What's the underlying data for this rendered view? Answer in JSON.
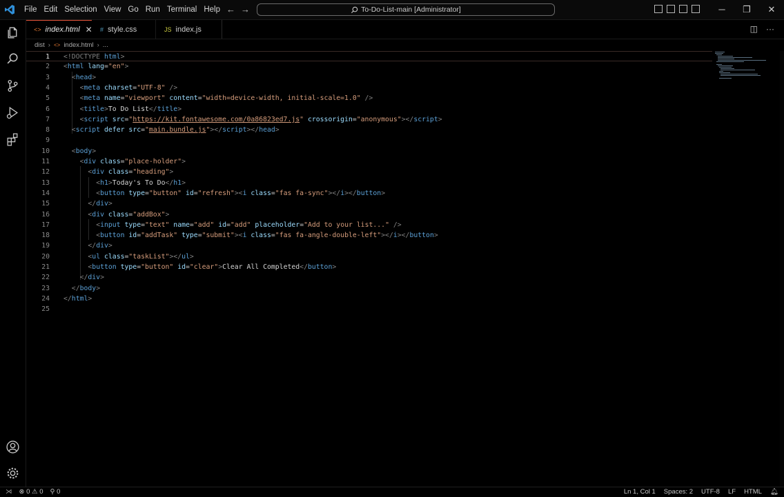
{
  "titlebar": {
    "menu": [
      "File",
      "Edit",
      "Selection",
      "View",
      "Go",
      "Run",
      "Terminal",
      "Help"
    ],
    "command_center": "To-Do-List-main [Administrator]"
  },
  "tabs": [
    {
      "icon": "<>",
      "label": "index.html",
      "active": true
    },
    {
      "icon": "#",
      "label": "style.css",
      "active": false
    },
    {
      "icon": "JS",
      "label": "index.js",
      "active": false
    }
  ],
  "breadcrumb": {
    "folder": "dist",
    "file": "index.html",
    "symbol": "..."
  },
  "editor": {
    "current_line": 1,
    "lines": [
      {
        "n": "1",
        "html": "<span class='t-tag'>&lt;!DOCTYPE</span><span class='t-name'> html</span><span class='t-tag'>&gt;</span>"
      },
      {
        "n": "2",
        "html": "<span class='t-tag'>&lt;</span><span class='t-name'>html</span> <span class='t-attr'>lang</span><span class='t-txt'>=</span><span class='t-val'>\"en\"</span><span class='t-tag'>&gt;</span>"
      },
      {
        "n": "3",
        "html": "  <span class='t-tag'>&lt;</span><span class='t-name'>head</span><span class='t-tag'>&gt;</span>"
      },
      {
        "n": "4",
        "html": "    <span class='t-tag'>&lt;</span><span class='t-name'>meta</span> <span class='t-attr'>charset</span><span class='t-txt'>=</span><span class='t-val'>\"UTF-8\"</span> <span class='t-tag'>/&gt;</span>"
      },
      {
        "n": "5",
        "html": "    <span class='t-tag'>&lt;</span><span class='t-name'>meta</span> <span class='t-attr'>name</span><span class='t-txt'>=</span><span class='t-val'>\"viewport\"</span> <span class='t-attr'>content</span><span class='t-txt'>=</span><span class='t-val'>\"width=device-width, initial-scale=1.0\"</span> <span class='t-tag'>/&gt;</span>"
      },
      {
        "n": "6",
        "html": "    <span class='t-tag'>&lt;</span><span class='t-name'>title</span><span class='t-tag'>&gt;</span><span class='t-txt'>To Do List</span><span class='t-tag'>&lt;/</span><span class='t-name'>title</span><span class='t-tag'>&gt;</span>"
      },
      {
        "n": "7",
        "html": "    <span class='t-tag'>&lt;</span><span class='t-name'>script</span> <span class='t-attr'>src</span><span class='t-txt'>=</span><span class='t-val'>\"</span><span class='t-link'>https://kit.fontawesome.com/0a86823ed7.js</span><span class='t-val'>\"</span> <span class='t-attr'>crossorigin</span><span class='t-txt'>=</span><span class='t-val'>\"anonymous\"</span><span class='t-tag'>&gt;&lt;/</span><span class='t-name'>script</span><span class='t-tag'>&gt;</span>"
      },
      {
        "n": "8",
        "html": "  <span class='t-tag'>&lt;</span><span class='t-name'>script</span> <span class='t-attr'>defer</span> <span class='t-attr'>src</span><span class='t-txt'>=</span><span class='t-val'>\"</span><span class='t-link'>main.bundle.js</span><span class='t-val'>\"</span><span class='t-tag'>&gt;&lt;/</span><span class='t-name'>script</span><span class='t-tag'>&gt;&lt;/</span><span class='t-name'>head</span><span class='t-tag'>&gt;</span>"
      },
      {
        "n": "9",
        "html": ""
      },
      {
        "n": "10",
        "html": "  <span class='t-tag'>&lt;</span><span class='t-name'>body</span><span class='t-tag'>&gt;</span>"
      },
      {
        "n": "11",
        "html": "    <span class='t-tag'>&lt;</span><span class='t-name'>div</span> <span class='t-attr'>class</span><span class='t-txt'>=</span><span class='t-val'>\"place-holder\"</span><span class='t-tag'>&gt;</span>"
      },
      {
        "n": "12",
        "html": "      <span class='t-tag'>&lt;</span><span class='t-name'>div</span> <span class='t-attr'>class</span><span class='t-txt'>=</span><span class='t-val'>\"heading\"</span><span class='t-tag'>&gt;</span>"
      },
      {
        "n": "13",
        "html": "        <span class='t-tag'>&lt;</span><span class='t-name'>h1</span><span class='t-tag'>&gt;</span><span class='t-txt'>Today's To Do</span><span class='t-tag'>&lt;/</span><span class='t-name'>h1</span><span class='t-tag'>&gt;</span>"
      },
      {
        "n": "14",
        "html": "        <span class='t-tag'>&lt;</span><span class='t-name'>button</span> <span class='t-attr'>type</span><span class='t-txt'>=</span><span class='t-val'>\"button\"</span> <span class='t-attr'>id</span><span class='t-txt'>=</span><span class='t-val'>\"refresh\"</span><span class='t-tag'>&gt;&lt;</span><span class='t-name'>i</span> <span class='t-attr'>class</span><span class='t-txt'>=</span><span class='t-val'>\"fas fa-sync\"</span><span class='t-tag'>&gt;&lt;/</span><span class='t-name'>i</span><span class='t-tag'>&gt;&lt;/</span><span class='t-name'>button</span><span class='t-tag'>&gt;</span>"
      },
      {
        "n": "15",
        "html": "      <span class='t-tag'>&lt;/</span><span class='t-name'>div</span><span class='t-tag'>&gt;</span>"
      },
      {
        "n": "16",
        "html": "      <span class='t-tag'>&lt;</span><span class='t-name'>div</span> <span class='t-attr'>class</span><span class='t-txt'>=</span><span class='t-val'>\"addBox\"</span><span class='t-tag'>&gt;</span>"
      },
      {
        "n": "17",
        "html": "        <span class='t-tag'>&lt;</span><span class='t-name'>input</span> <span class='t-attr'>type</span><span class='t-txt'>=</span><span class='t-val'>\"text\"</span> <span class='t-attr'>name</span><span class='t-txt'>=</span><span class='t-val'>\"add\"</span> <span class='t-attr'>id</span><span class='t-txt'>=</span><span class='t-val'>\"add\"</span> <span class='t-attr'>placeholder</span><span class='t-txt'>=</span><span class='t-val'>\"Add to your list...\"</span> <span class='t-tag'>/&gt;</span>"
      },
      {
        "n": "18",
        "html": "        <span class='t-tag'>&lt;</span><span class='t-name'>button</span> <span class='t-attr'>id</span><span class='t-txt'>=</span><span class='t-val'>\"addTask\"</span> <span class='t-attr'>type</span><span class='t-txt'>=</span><span class='t-val'>\"submit\"</span><span class='t-tag'>&gt;&lt;</span><span class='t-name'>i</span> <span class='t-attr'>class</span><span class='t-txt'>=</span><span class='t-val'>\"fas fa-angle-double-left\"</span><span class='t-tag'>&gt;&lt;/</span><span class='t-name'>i</span><span class='t-tag'>&gt;&lt;/</span><span class='t-name'>button</span><span class='t-tag'>&gt;</span>"
      },
      {
        "n": "19",
        "html": "      <span class='t-tag'>&lt;/</span><span class='t-name'>div</span><span class='t-tag'>&gt;</span>"
      },
      {
        "n": "20",
        "html": "      <span class='t-tag'>&lt;</span><span class='t-name'>ul</span> <span class='t-attr'>class</span><span class='t-txt'>=</span><span class='t-val'>\"taskList\"</span><span class='t-tag'>&gt;&lt;/</span><span class='t-name'>ul</span><span class='t-tag'>&gt;</span>"
      },
      {
        "n": "21",
        "html": "      <span class='t-tag'>&lt;</span><span class='t-name'>button</span> <span class='t-attr'>type</span><span class='t-txt'>=</span><span class='t-val'>\"button\"</span> <span class='t-attr'>id</span><span class='t-txt'>=</span><span class='t-val'>\"clear\"</span><span class='t-tag'>&gt;</span><span class='t-txt'>Clear All Completed</span><span class='t-tag'>&lt;/</span><span class='t-name'>button</span><span class='t-tag'>&gt;</span>"
      },
      {
        "n": "22",
        "html": "    <span class='t-tag'>&lt;/</span><span class='t-name'>div</span><span class='t-tag'>&gt;</span>"
      },
      {
        "n": "23",
        "html": "  <span class='t-tag'>&lt;/</span><span class='t-name'>body</span><span class='t-tag'>&gt;</span>"
      },
      {
        "n": "24",
        "html": "<span class='t-tag'>&lt;/</span><span class='t-name'>html</span><span class='t-tag'>&gt;</span>"
      },
      {
        "n": "25",
        "html": ""
      }
    ]
  },
  "statusbar": {
    "errors": "0",
    "warnings": "0",
    "ports": "0",
    "position": "Ln 1, Col 1",
    "spaces": "Spaces: 2",
    "encoding": "UTF-8",
    "eol": "LF",
    "language": "HTML"
  },
  "colors": {
    "accent_tab_border": "#e8543a",
    "vscode_blue": "#2f8fd8"
  }
}
